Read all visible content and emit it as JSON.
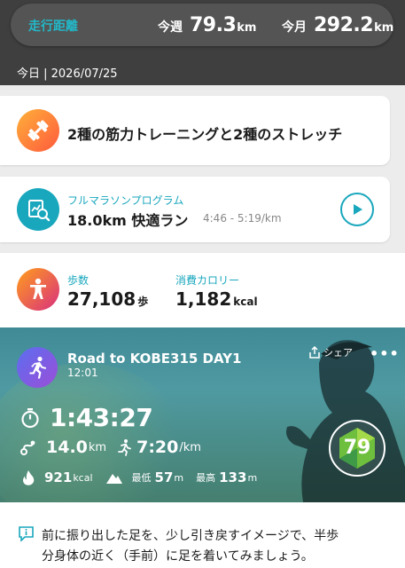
{
  "summary": {
    "label": "走行距離",
    "week_label": "今週",
    "week_value": "79.3",
    "week_unit": "km",
    "month_label": "今月",
    "month_value": "292.2",
    "month_unit": "km"
  },
  "date_line": "今日 | 2026/07/25",
  "strength_card": {
    "title": "2種の筋力トレーニングと2種のストレッチ",
    "icon": "dumbbell-icon"
  },
  "program_card": {
    "subtitle": "フルマラソンプログラム",
    "title": "18.0km 快適ラン",
    "pace": "4:46 - 5:19/km",
    "icon": "program-search-icon"
  },
  "stats_card": {
    "steps_label": "歩数",
    "steps_value": "27,108",
    "steps_unit": "歩",
    "calorie_label": "消費カロリー",
    "calorie_value": "1,182",
    "calorie_unit": "kcal"
  },
  "activity": {
    "name": "Road to KOBE315 DAY1",
    "time": "12:01",
    "share_label": "シェア",
    "more_label": "•••",
    "duration": "1:43:27",
    "distance_value": "14.0",
    "distance_unit": "km",
    "pace_value": "7:20",
    "pace_unit": "/km",
    "calories_value": "921",
    "calories_unit": "kcal",
    "min_label": "最低",
    "min_value": "57",
    "min_unit": "m",
    "max_label": "最高",
    "max_value": "133",
    "max_unit": "m",
    "score": "79"
  },
  "tip": {
    "line1": "前に振り出した足を、少し引き戻すイメージで、半歩",
    "line2": "分身体の近く（手前）に足を着いてみましょう。"
  },
  "colors": {
    "accent": "#19a7bd",
    "header_bg": "#3f3f3f",
    "pill_bg": "#545454",
    "score_green": "#7ec84a"
  }
}
